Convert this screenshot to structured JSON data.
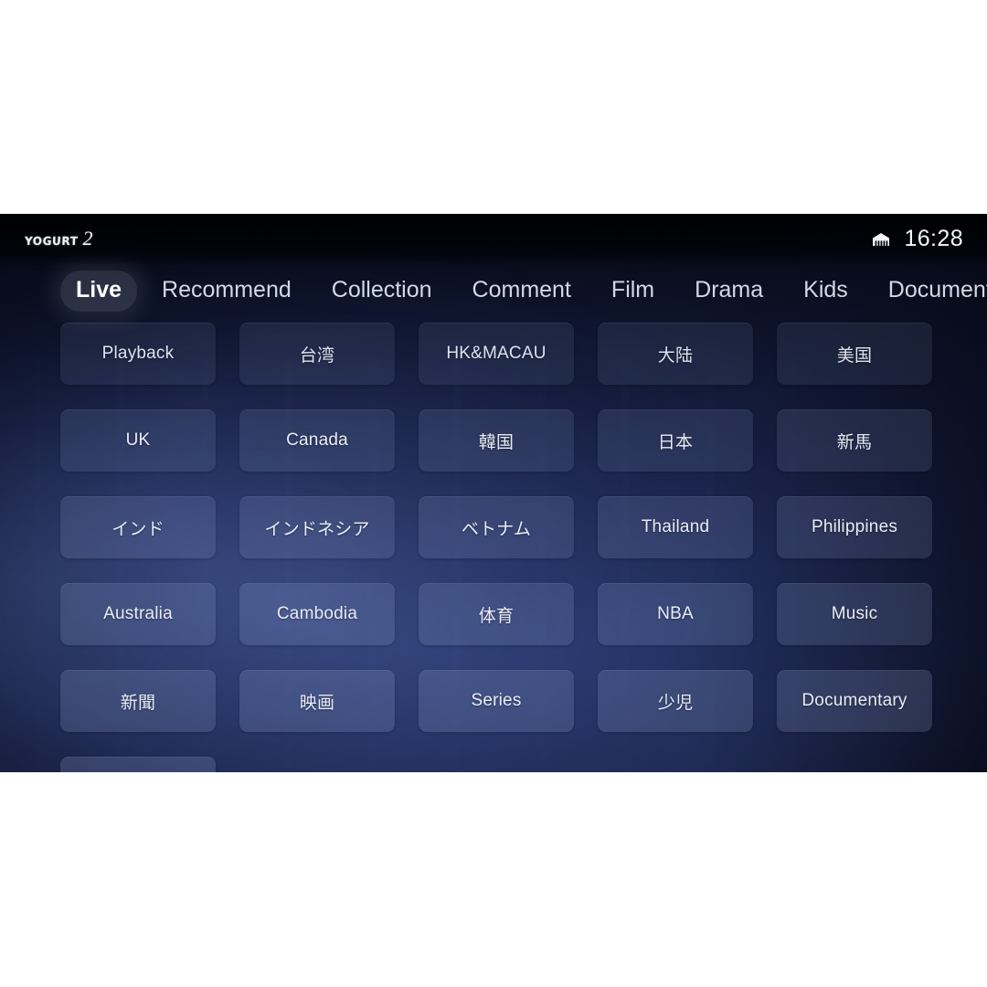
{
  "statusbar": {
    "logo_word": "Yogurt",
    "logo_number": "2",
    "network_icon": "ethernet-icon",
    "clock": "16:28"
  },
  "tabs": [
    {
      "label": "Live",
      "active": true
    },
    {
      "label": "Recommend",
      "active": false
    },
    {
      "label": "Collection",
      "active": false
    },
    {
      "label": "Comment",
      "active": false
    },
    {
      "label": "Film",
      "active": false
    },
    {
      "label": "Drama",
      "active": false
    },
    {
      "label": "Kids",
      "active": false
    },
    {
      "label": "Documentary",
      "active": false
    }
  ],
  "grid": {
    "columns": 5,
    "tiles": [
      {
        "label": "Playback"
      },
      {
        "label": "台湾"
      },
      {
        "label": "HK&MACAU"
      },
      {
        "label": "大陆"
      },
      {
        "label": "美国"
      },
      {
        "label": "UK"
      },
      {
        "label": "Canada"
      },
      {
        "label": "韓国"
      },
      {
        "label": "日本"
      },
      {
        "label": "新馬"
      },
      {
        "label": "インド"
      },
      {
        "label": "インドネシア"
      },
      {
        "label": "ベトナム"
      },
      {
        "label": "Thailand"
      },
      {
        "label": "Philippines"
      },
      {
        "label": "Australia"
      },
      {
        "label": "Cambodia"
      },
      {
        "label": "体育"
      },
      {
        "label": "NBA"
      },
      {
        "label": "Music"
      },
      {
        "label": "新聞"
      },
      {
        "label": "映画"
      },
      {
        "label": "Series"
      },
      {
        "label": "少児"
      },
      {
        "label": "Documentary"
      },
      {
        "label": ""
      }
    ]
  },
  "colors": {
    "screen_top": "#05070f",
    "screen_bottom": "#2e3d77",
    "statusbar": "#000103",
    "tile_fill": "rgba(152,168,214,0.165)",
    "text_primary": "#ffffff",
    "text_secondary": "#d3d8e4",
    "letterbox": "#ffffff"
  }
}
